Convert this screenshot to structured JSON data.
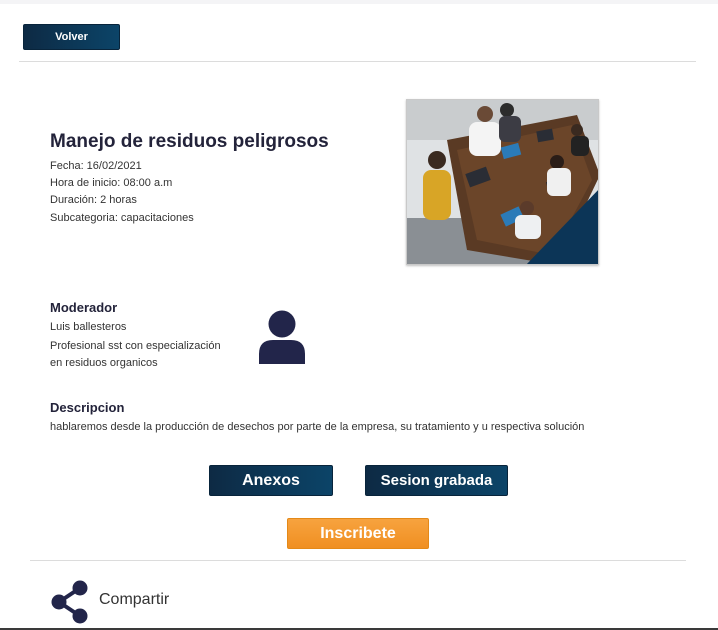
{
  "header": {
    "back_label": "Volver"
  },
  "event": {
    "title": "Manejo de residuos peligrosos",
    "date": "Fecha: 16/02/2021",
    "start_time": "Hora de inicio: 08:00 a.m",
    "duration": "Duración: 2 horas",
    "subcategory": "Subcategoria: capacitaciones"
  },
  "moderator": {
    "heading": "Moderador",
    "name": "Luis ballesteros",
    "description": "Profesional sst con especialización en residuos organicos",
    "icon": "user-avatar-icon"
  },
  "description": {
    "heading": "Descripcion",
    "text": "hablaremos desde la producción de desechos por parte de la empresa, su tratamiento y u respectiva solución"
  },
  "actions": {
    "anexos_label": "Anexos",
    "session_label": "Sesion grabada",
    "enroll_label": "Inscribete"
  },
  "share": {
    "label": "Compartir",
    "icon": "share-icon"
  },
  "colors": {
    "primary_dark": "#0d2a44",
    "accent_orange": "#f29426",
    "icon_navy": "#22254a"
  }
}
